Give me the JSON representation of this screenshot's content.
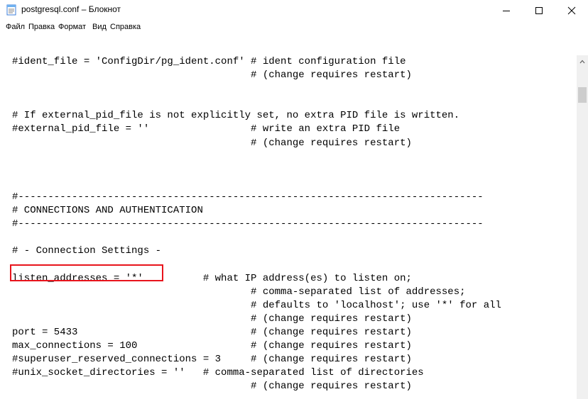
{
  "window": {
    "title": "postgresql.conf – Блокнот",
    "icon": "notepad-icon"
  },
  "menu": [
    {
      "label": "Файл"
    },
    {
      "label": "Правка"
    },
    {
      "label": "Формат"
    },
    {
      "label": "Вид"
    },
    {
      "label": "Справка"
    }
  ],
  "editor": {
    "lines": [
      "#ident_file = 'ConfigDir/pg_ident.conf' # ident configuration file",
      "                                        # (change requires restart)",
      "",
      "",
      "# If external_pid_file is not explicitly set, no extra PID file is written.",
      "#external_pid_file = ''                 # write an extra PID file",
      "                                        # (change requires restart)",
      "",
      "",
      "",
      "#------------------------------------------------------------------------------",
      "# CONNECTIONS AND AUTHENTICATION",
      "#------------------------------------------------------------------------------",
      "",
      "# - Connection Settings -",
      "",
      "listen_addresses = '*'          # what IP address(es) to listen on;",
      "                                        # comma-separated list of addresses;",
      "                                        # defaults to 'localhost'; use '*' for all",
      "                                        # (change requires restart)",
      "port = 5433                             # (change requires restart)",
      "max_connections = 100                   # (change requires restart)",
      "#superuser_reserved_connections = 3     # (change requires restart)",
      "#unix_socket_directories = ''   # comma-separated list of directories",
      "                                        # (change requires restart)"
    ],
    "highlighted_line": "listen_addresses = '*'"
  },
  "colors": {
    "highlight_border": "#e8141c",
    "scrollbar_track": "#f0f0f0",
    "scrollbar_thumb": "#cdcdcd"
  }
}
